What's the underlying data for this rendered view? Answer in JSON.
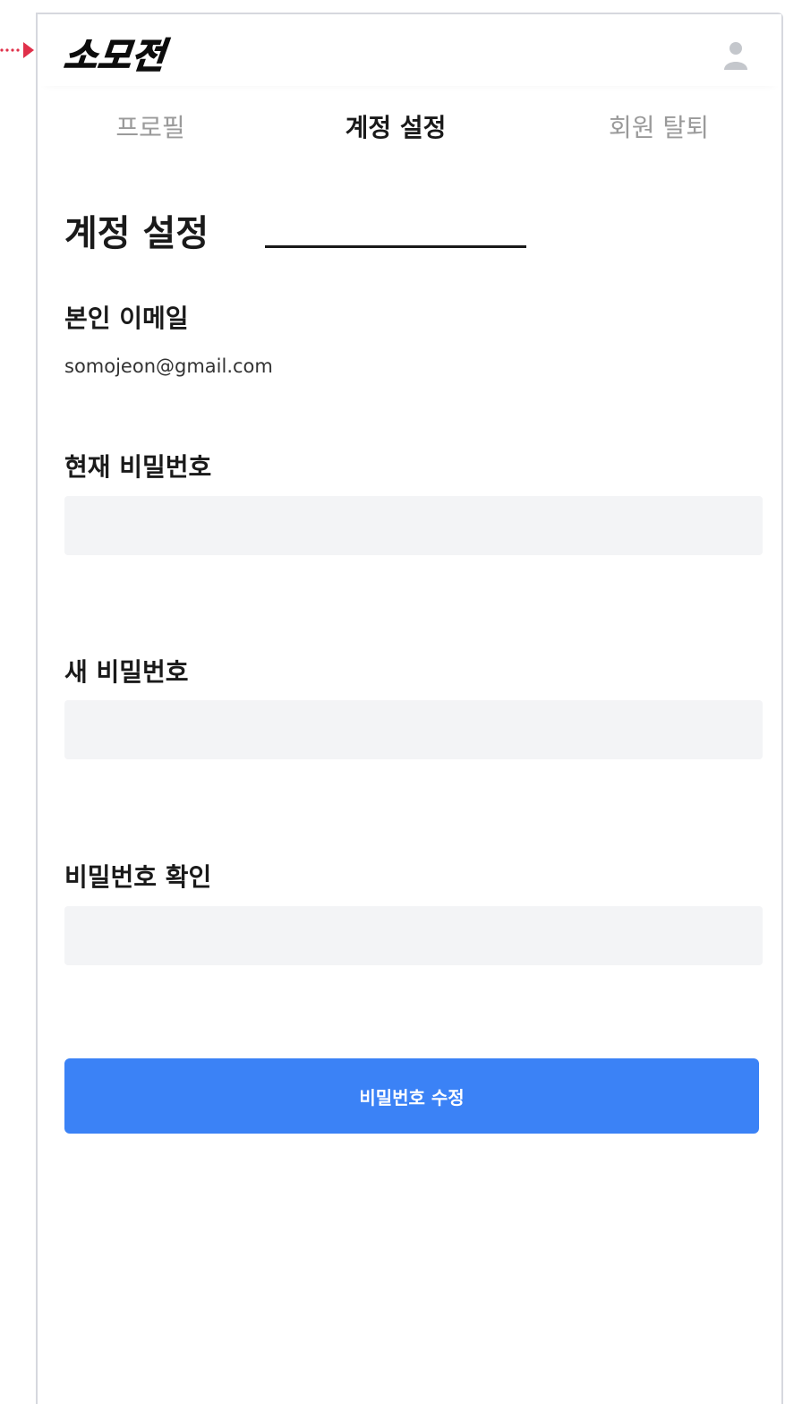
{
  "app": {
    "logo_text": "소모전"
  },
  "header": {
    "user_icon": "user-icon"
  },
  "tabs": [
    {
      "label": "프로필",
      "active": false
    },
    {
      "label": "계정 설정",
      "active": true
    },
    {
      "label": "회원 탈퇴",
      "active": false
    }
  ],
  "page": {
    "title": "계정 설정"
  },
  "email_section": {
    "label": "본인 이메일",
    "value": "somojeon@gmail.com"
  },
  "current_password": {
    "label": "현재 비밀번호",
    "value": "",
    "placeholder": ""
  },
  "new_password": {
    "label": "새 비밀번호",
    "value": "",
    "placeholder": ""
  },
  "confirm_password": {
    "label": "비밀번호 확인",
    "value": "",
    "placeholder": ""
  },
  "submit": {
    "label": "비밀번호 수정"
  },
  "colors": {
    "accent": "#3b82f6",
    "pointer": "#e0304a",
    "input_bg": "#f3f4f6",
    "text_primary": "#1a1a1a",
    "text_muted": "#9a9a9a"
  }
}
